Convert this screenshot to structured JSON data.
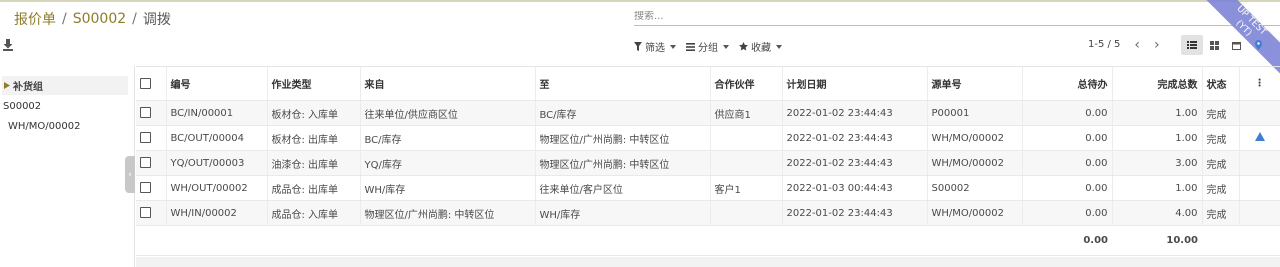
{
  "breadcrumb": {
    "part1": "报价单",
    "sep1": "/",
    "part2": "S00002",
    "sep2": "/",
    "current": "调拨"
  },
  "search": {
    "placeholder": "搜索..."
  },
  "ribbon": {
    "line1": "UP TEST",
    "line2": "(YT)"
  },
  "filters": {
    "filter": "筛选",
    "group": "分组",
    "favorite": "收藏"
  },
  "pager": {
    "value": "1-5 / 5"
  },
  "panel": {
    "title": "补货组",
    "item1": "S00002",
    "item2": "WH/MO/00002"
  },
  "table": {
    "headers": [
      "编号",
      "作业类型",
      "来自",
      "至",
      "合作伙伴",
      "计划日期",
      "源单号",
      "总待办",
      "完成总数",
      "状态"
    ],
    "rows": [
      [
        "BC/IN/00001",
        "板材仓: 入库单",
        "往来单位/供应商区位",
        "BC/库存",
        "供应商1",
        "2022-01-02 23:44:43",
        "P00001",
        "0.00",
        "1.00",
        "完成"
      ],
      [
        "BC/OUT/00004",
        "板材仓: 出库单",
        "BC/库存",
        "物理区位/广州尚鹏: 中转区位",
        "",
        "2022-01-02 23:44:43",
        "WH/MO/00002",
        "0.00",
        "1.00",
        "完成"
      ],
      [
        "YQ/OUT/00003",
        "油漆仓: 出库单",
        "YQ/库存",
        "物理区位/广州尚鹏: 中转区位",
        "",
        "2022-01-02 23:44:43",
        "WH/MO/00002",
        "0.00",
        "3.00",
        "完成"
      ],
      [
        "WH/OUT/00002",
        "成品仓: 出库单",
        "WH/库存",
        "往来单位/客户区位",
        "客户1",
        "2022-01-03 00:44:43",
        "S00002",
        "0.00",
        "1.00",
        "完成"
      ],
      [
        "WH/IN/00002",
        "成品仓: 入库单",
        "物理区位/广州尚鹏: 中转区位",
        "WH/库存",
        "",
        "2022-01-02 23:44:43",
        "WH/MO/00002",
        "0.00",
        "4.00",
        "完成"
      ]
    ],
    "totals": {
      "todo": "0.00",
      "done": "10.00"
    }
  },
  "colors": {
    "breadcrumb_link": "#8f7d2b",
    "ribbon": "#7e85d6",
    "warning_icon": "#3e7ed5"
  }
}
